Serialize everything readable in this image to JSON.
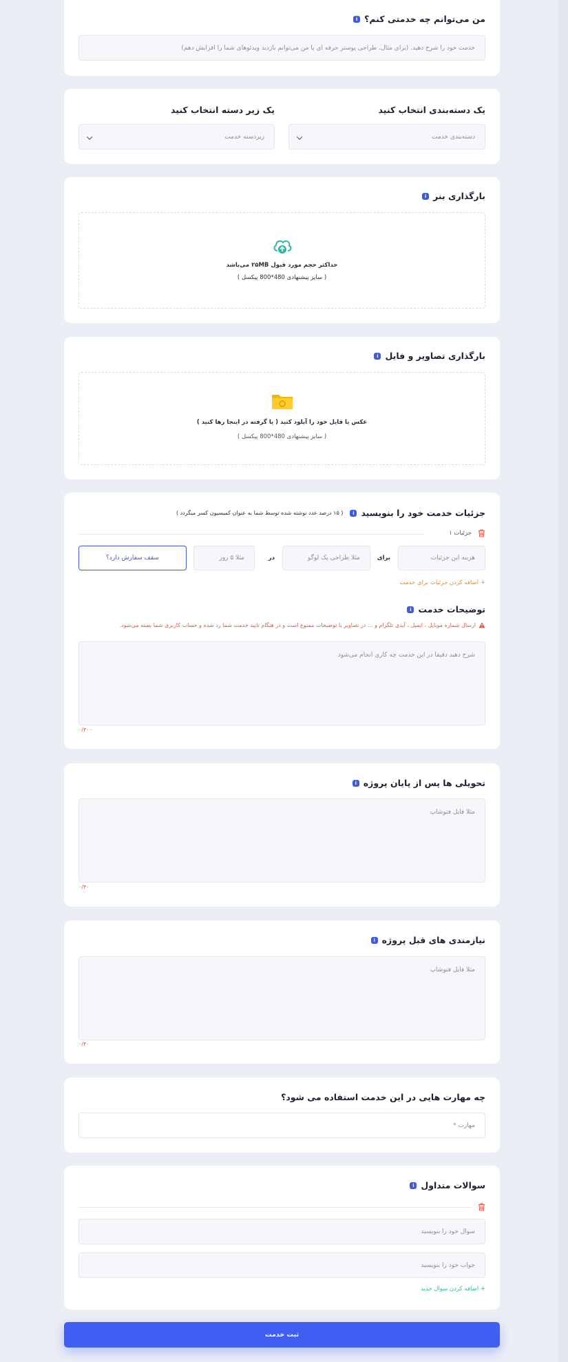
{
  "service_title": {
    "label": "من می‌توانم چه خدمتی کنم؟",
    "placeholder": "خدمت خود را شرح دهید. (برای مثال، طراحی پوستر حرفه ای یا من می‌توانم بازدید ویدئوهای شما را افزایش دهم)"
  },
  "category": {
    "label": "یک دسته‌بندی انتخاب کنید",
    "placeholder": "دسته‌بندی خدمت",
    "sub_label": "یک زیر دسته انتخاب کنید",
    "sub_placeholder": "زیردسته خدمت"
  },
  "banner_upload": {
    "label": "بارگذاری بنر",
    "line1": "حداکثر حجم مورد قبول ۲۵MB می‌باشد",
    "line2": "( سایز پیشنهادی 480*800 پیکسل )"
  },
  "files_upload": {
    "label": "بارگذاری تصاویر و فایل",
    "line1": "عکس یا فایل خود را آپلود کنید ( یا گرفته در اینجا رها کنید )",
    "line2": "( سایز پیشنهادی 480*800 پیکسل )"
  },
  "details": {
    "label": "جزئیات خدمت خود را بنویسید",
    "note": "( ۱۵ درصد عدد نوشته شده توسط شما به عنوان کمیسیون کسر میگردد )",
    "item_label": "جزئیات ۱",
    "cost_placeholder": "هزینه این جزئیات",
    "for_label": "برای",
    "for_placeholder": "مثلا طراحی یک لوگو",
    "in_label": "در",
    "days_placeholder": "مثلا ۵ روز",
    "cap_button": "سقف سفارش دارد؟",
    "add_link": "+ اضافه کردن جزئیات برای خدمت"
  },
  "description": {
    "label": "توضیحات خدمت",
    "warning": "ارسال شماره موبایل ، ایمیل ، آیدی تلگرام و ... در تصاویر یا توضیحات ممنوع است و در هنگام تایید خدمت شما رد شده و حساب کاربری شما بسته می‌شود.",
    "placeholder": "شرح دهید دقیقا در این خدمت چه کاری انجام می‌شود",
    "counter": "۰/۳۰۰"
  },
  "deliverables": {
    "label": "تحویلی ها پس از پایان پروژه",
    "placeholder": "مثلا فایل فتوشاپ",
    "counter": "۰/۴۰"
  },
  "requirements": {
    "label": "نیازمندی های قبل پروژه",
    "placeholder": "مثلا فایل فتوشاپ",
    "counter": "۰/۴۰"
  },
  "skills": {
    "label": "چه مهارت هایی در این خدمت استفاده می شود؟",
    "placeholder": "مهارت *"
  },
  "faq": {
    "label": "سوالات متداول",
    "question_placeholder": "سوال خود را بنویسید",
    "answer_placeholder": "جواب خود را بنویسید",
    "add_link": "+ اضافه کردن سوال جدید"
  },
  "submit_label": "ثبت خدمت",
  "info_glyph": "i",
  "colors": {
    "accent": "#3f5ff2",
    "info": "#3d5bdb",
    "warning": "#e2574c",
    "orange_link": "#e8892a",
    "teal_link": "#2fb5a0"
  },
  "icons": [
    "info-icon",
    "cloud-upload-icon",
    "folder-icon",
    "trash-icon",
    "warning-icon",
    "chevron-down-icon"
  ]
}
